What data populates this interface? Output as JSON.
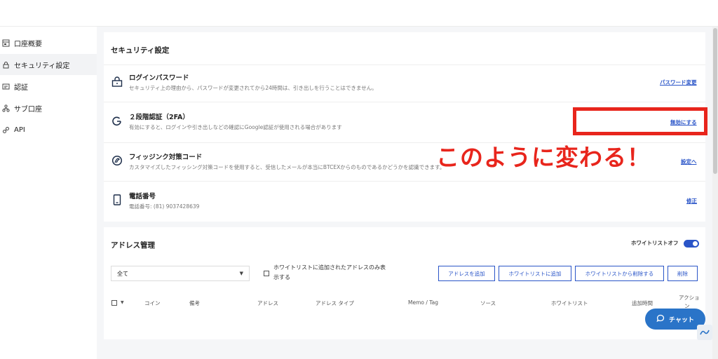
{
  "sidebar": {
    "items": [
      {
        "label": "口座概要",
        "icon": "account-overview-icon"
      },
      {
        "label": "セキュリティ設定",
        "icon": "lock-icon"
      },
      {
        "label": "認証",
        "icon": "id-card-icon"
      },
      {
        "label": "サブ口座",
        "icon": "sub-account-icon"
      },
      {
        "label": "API",
        "icon": "api-icon"
      }
    ],
    "active_index": 1
  },
  "security": {
    "title": "セキュリティ設定",
    "rows": [
      {
        "title": "ログインパスワード",
        "desc": "セキュリティ上の理由から、パスワードが変更されてから24時間は、引き出しを行うことはできません。",
        "action": "パスワード変更",
        "icon": "lock-icon"
      },
      {
        "title": "２段階認証（2FA）",
        "desc": "有効にすると、ログインや引き出しなどの確認にGoogle認証が使用される場合があります",
        "action": "無効にする",
        "icon": "google-icon"
      },
      {
        "title": "フィッジンク対策コード",
        "desc": "カスタマイズしたフィッシング対策コードを使用すると、受信したメールが本当にBTCEXからのものであるかどうかを認識できます。",
        "action": "設定へ",
        "icon": "anti-phishing-icon"
      },
      {
        "title": "電話番号",
        "desc": "電話番号: (81) 9037428639",
        "action": "修正",
        "icon": "phone-icon"
      }
    ]
  },
  "annotation": {
    "text": "このように変わる！",
    "color": "#e8251c"
  },
  "address": {
    "title": "アドレス管理",
    "whitelist_toggle_label": "ホワイトリストオフ",
    "filter_value": "全て",
    "checkbox_label_line1": "ホワイトリストに追加されたアドレスのみ表",
    "checkbox_label_line2": "示する",
    "buttons": [
      "アドレスを追加",
      "ホワイトリストに追加",
      "ホワイトリストから削除する",
      "削除"
    ],
    "columns": [
      "コイン",
      "備考",
      "アドレス",
      "アドレス タイプ",
      "Memo / Tag",
      "ソース",
      "ホワイトリスト",
      "追加時間",
      "アクショ",
      "ン"
    ]
  },
  "chat": {
    "label": "チャット"
  },
  "colors": {
    "accent": "#2a55c8",
    "annotation_red": "#e8251c",
    "chat_blue": "#2a74c8"
  }
}
